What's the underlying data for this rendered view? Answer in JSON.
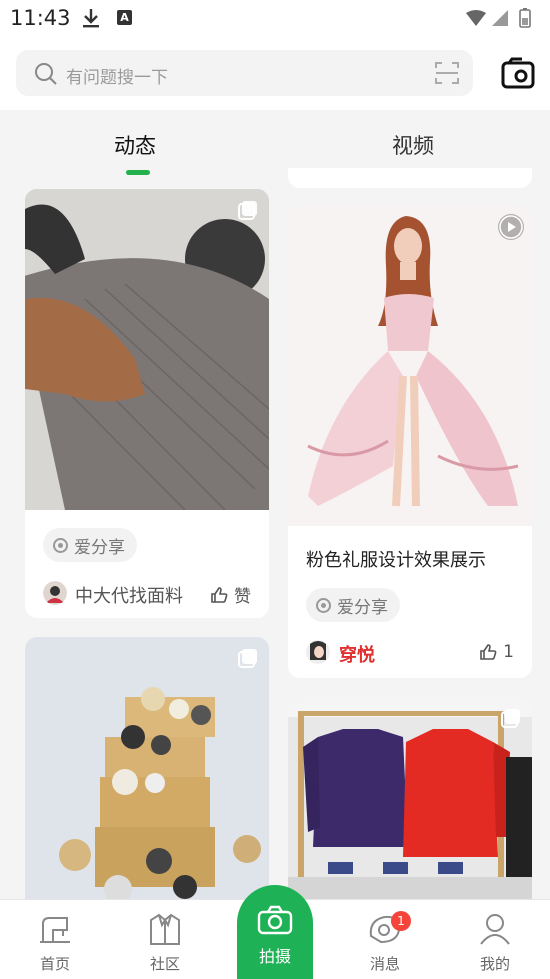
{
  "status_bar": {
    "time": "11:43"
  },
  "search": {
    "placeholder": "有问题搜一下"
  },
  "tabs": [
    {
      "label": "动态",
      "active": true
    },
    {
      "label": "视频",
      "active": false
    }
  ],
  "feed_left": [
    {
      "tag": "爱分享",
      "author": "中大代找面料",
      "likes_label": "赞",
      "media": "fabric-photo"
    },
    {
      "media": "buttons-photo"
    }
  ],
  "feed_right": [
    {
      "title": "粉色礼服设计效果展示",
      "tag": "爱分享",
      "author": "穿悦",
      "likes": "1",
      "media": "gown-illustration",
      "is_video": true,
      "author_color": "#e03030"
    },
    {
      "media": "jackets-photo"
    }
  ],
  "bottom_nav": [
    {
      "label": "首页",
      "icon": "sewing-machine-icon"
    },
    {
      "label": "社区",
      "icon": "shirt-icon"
    },
    {
      "label": "拍摄",
      "icon": "camera-icon",
      "primary": true
    },
    {
      "label": "消息",
      "icon": "message-icon",
      "badge": "1"
    },
    {
      "label": "我的",
      "icon": "profile-icon"
    }
  ],
  "colors": {
    "accent": "#1fb155",
    "badge": "#f5443a"
  }
}
